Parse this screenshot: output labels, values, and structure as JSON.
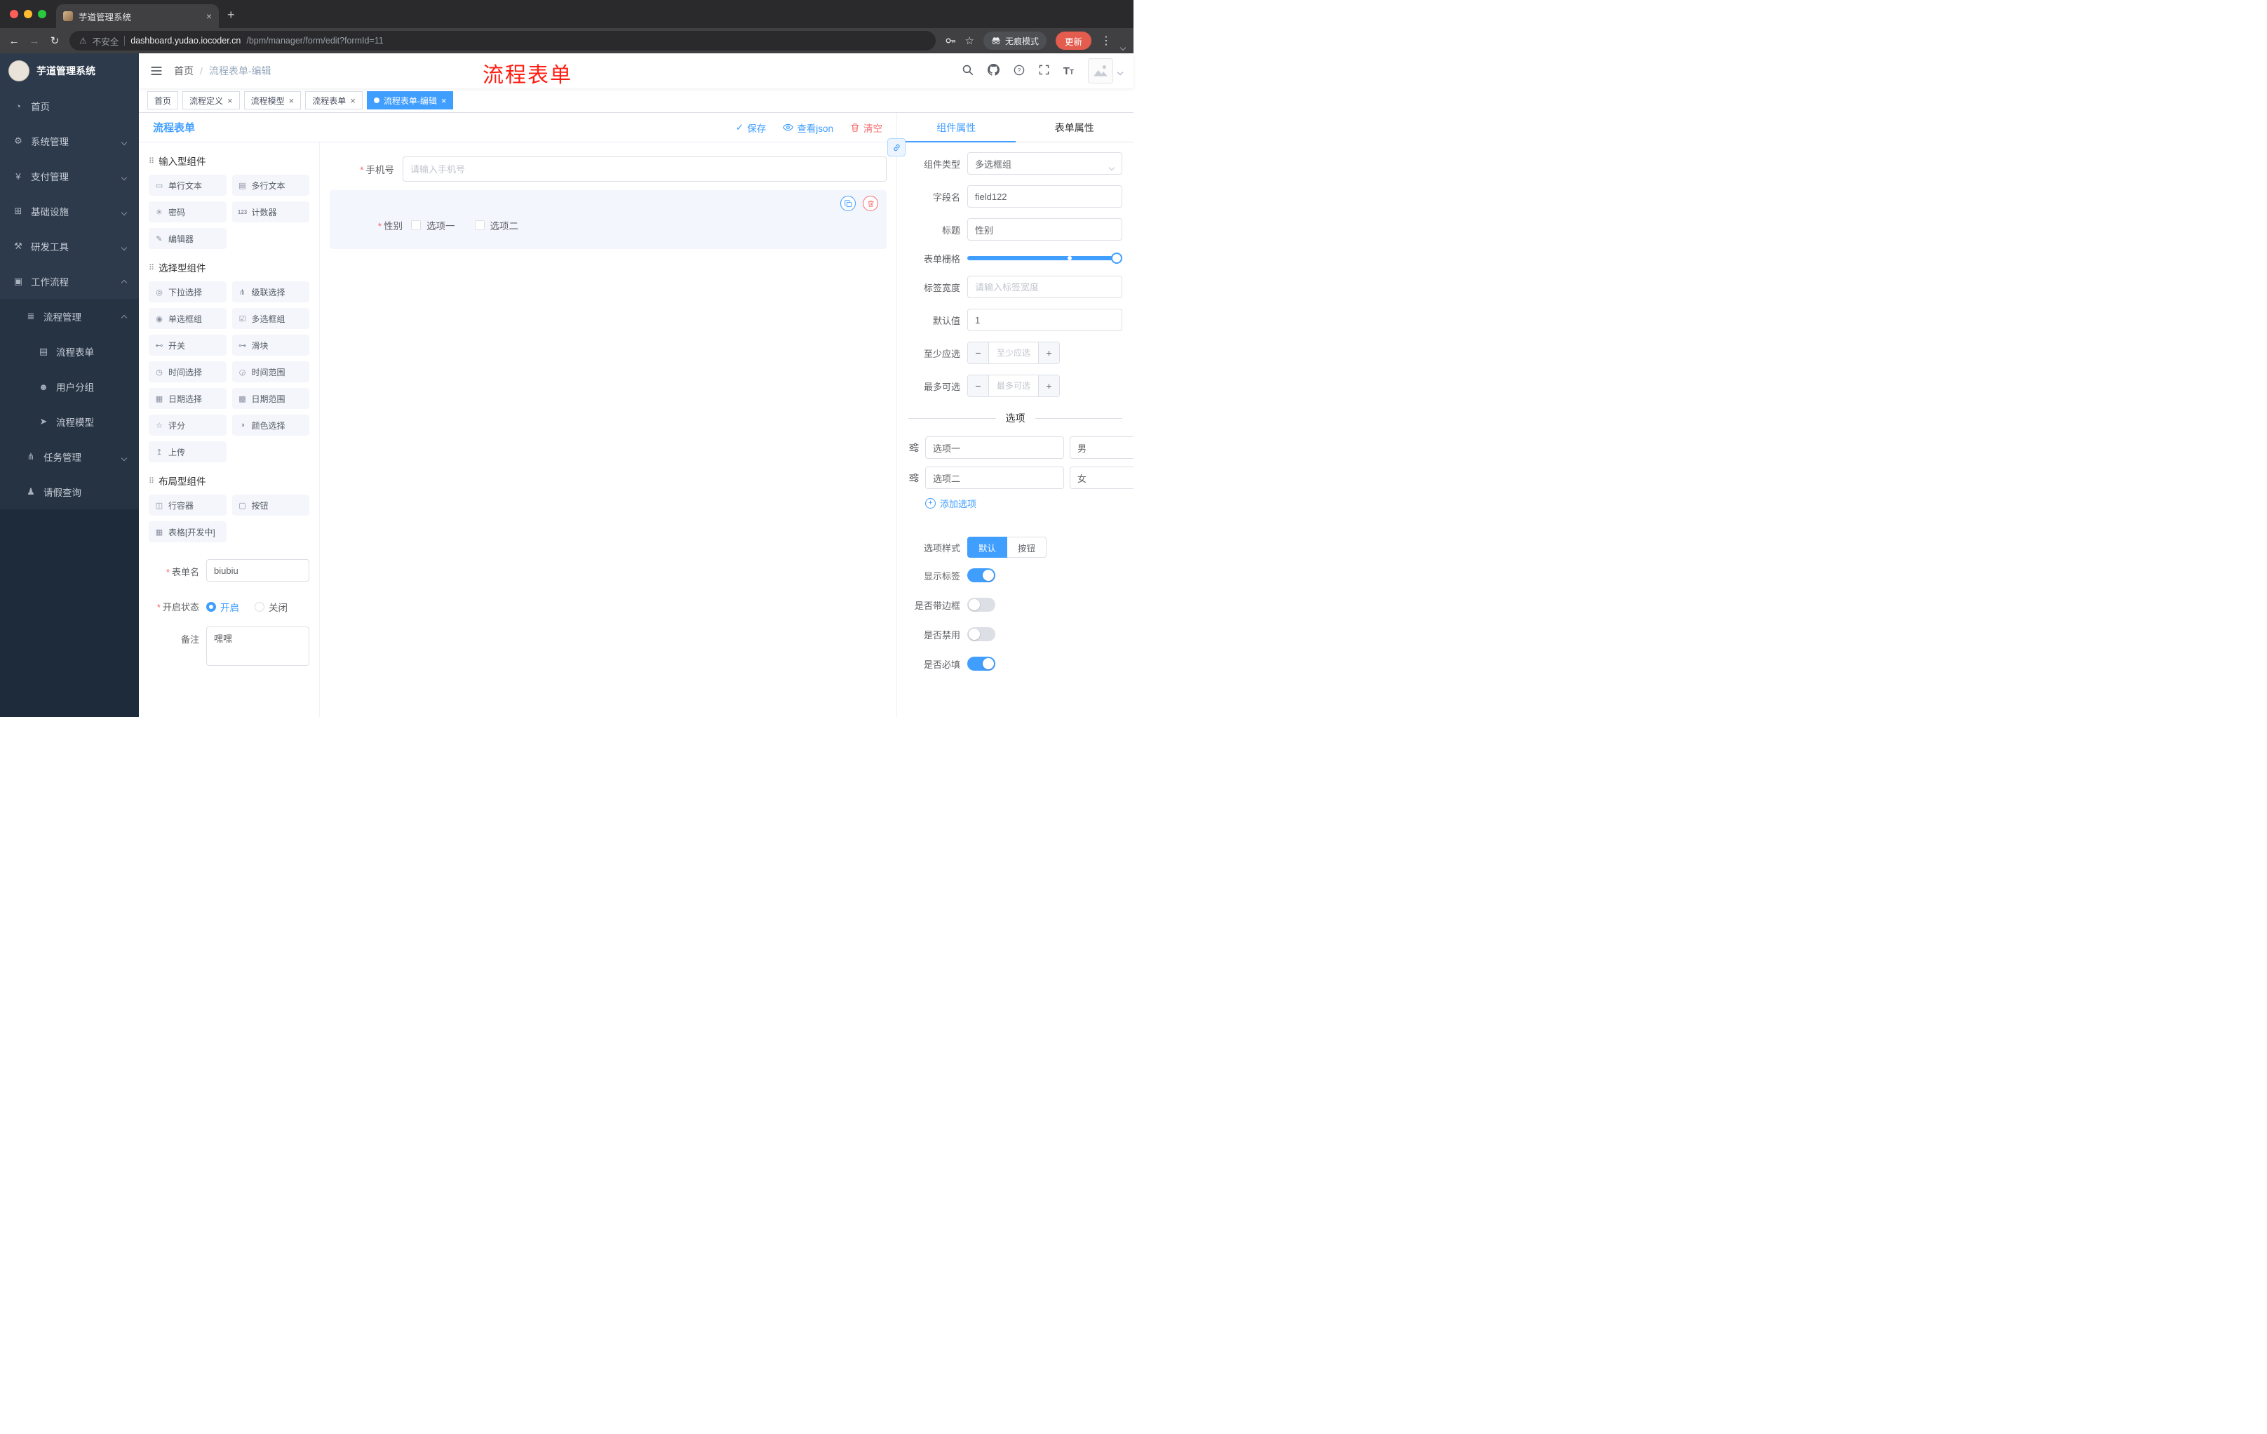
{
  "colors": {
    "primary": "#409eff",
    "danger": "#f56c6c",
    "annotation_red": "#fe1d12",
    "active_tag": "#409eff"
  },
  "icons": {
    "close": "×",
    "plus": "+",
    "minus": "−",
    "check": "✓",
    "dots": "⋮",
    "back": "←",
    "forward": "→",
    "reload": "↻",
    "warning": "⚠",
    "star": "☆",
    "menu_home": "◔",
    "menu_system": "⚙",
    "menu_pay": "¥",
    "menu_infra": "⊞",
    "menu_dev": "⚒",
    "menu_workflow": "▣",
    "menu_bpm": "≣",
    "menu_form": "▤",
    "menu_user_group": "☻",
    "menu_model": "➤",
    "menu_task": "⋔",
    "menu_leave": "♟",
    "group_handle": "⠿",
    "comp_single_line": "▭",
    "comp_multi_line": "▤",
    "comp_password": "✳",
    "comp_counter": "123",
    "comp_editor": "✎",
    "comp_select": "◎",
    "comp_cascader": "⋔",
    "comp_radio": "◉",
    "comp_checkbox": "☑",
    "comp_switch": "⊷",
    "comp_slider": "⊶",
    "comp_time": "◷",
    "comp_time_range": "◶",
    "comp_date": "▦",
    "comp_date_range": "▩",
    "comp_rate": "☆",
    "comp_color": "◑",
    "comp_upload": "↥",
    "comp_row": "◫",
    "comp_button": "▢",
    "comp_table": "▦"
  },
  "browser": {
    "tab": {
      "title": "芋道管理系统"
    },
    "address": {
      "security_label": "不安全",
      "host": "dashboard.yudao.iocoder.cn",
      "path": "/bpm/manager/form/edit?formId=11"
    },
    "incognito_label": "无痕模式",
    "update_label": "更新"
  },
  "sidebar": {
    "logo_title": "芋道管理系统",
    "menu": [
      {
        "label": "首页"
      },
      {
        "label": "系统管理"
      },
      {
        "label": "支付管理"
      },
      {
        "label": "基础设施"
      },
      {
        "label": "研发工具"
      },
      {
        "label": "工作流程"
      },
      {
        "label": "流程管理"
      },
      {
        "label": "流程表单"
      },
      {
        "label": "用户分组"
      },
      {
        "label": "流程模型"
      },
      {
        "label": "任务管理"
      },
      {
        "label": "请假查询"
      }
    ]
  },
  "navbar": {
    "breadcrumb": {
      "home": "首页",
      "current": "流程表单-编辑"
    },
    "annotation": "流程表单"
  },
  "tags": [
    {
      "label": "首页"
    },
    {
      "label": "流程定义"
    },
    {
      "label": "流程模型"
    },
    {
      "label": "流程表单"
    },
    {
      "label": "流程表单-编辑"
    }
  ],
  "designer": {
    "title": "流程表单",
    "actions": {
      "save": "保存",
      "view_json": "查看json",
      "clear": "清空"
    },
    "palette": {
      "groups": [
        {
          "title": "输入型组件",
          "items": [
            "单行文本",
            "多行文本",
            "密码",
            "计数器",
            "编辑器"
          ]
        },
        {
          "title": "选择型组件",
          "items": [
            "下拉选择",
            "级联选择",
            "单选框组",
            "多选框组",
            "开关",
            "滑块",
            "时间选择",
            "时间范围",
            "日期选择",
            "日期范围",
            "评分",
            "颜色选择",
            "上传"
          ]
        },
        {
          "title": "布局型组件",
          "items": [
            "行容器",
            "按钮",
            "表格[开发中]"
          ]
        }
      ]
    },
    "meta": {
      "form_name": {
        "label": "表单名",
        "value": "biubiu"
      },
      "status": {
        "label": "开启状态",
        "options": [
          "开启",
          "关闭"
        ],
        "selected": "开启"
      },
      "remark": {
        "label": "备注",
        "value": "嘿嘿"
      }
    },
    "canvas": {
      "phone": {
        "label": "手机号",
        "placeholder": "请输入手机号"
      },
      "gender": {
        "label": "性别",
        "options": [
          "选项一",
          "选项二"
        ]
      }
    }
  },
  "props": {
    "tabs": {
      "component": "组件属性",
      "form": "表单属性"
    },
    "component_type": {
      "label": "组件类型",
      "value": "多选框组"
    },
    "field_name": {
      "label": "字段名",
      "value": "field122"
    },
    "title": {
      "label": "标题",
      "value": "性别"
    },
    "grid": {
      "label": "表单栅格"
    },
    "label_width": {
      "label": "标签宽度",
      "placeholder": "请输入标签宽度"
    },
    "default_value": {
      "label": "默认值",
      "value": "1"
    },
    "min_select": {
      "label": "至少应选",
      "placeholder": "至少应选"
    },
    "max_select": {
      "label": "最多可选",
      "placeholder": "最多可选"
    },
    "options": {
      "divider": "选项",
      "rows": [
        {
          "label": "选项一",
          "value": "男"
        },
        {
          "label": "选项二",
          "value": "女"
        }
      ],
      "add_label": "添加选项"
    },
    "option_style": {
      "label": "选项样式",
      "options": [
        "默认",
        "按钮"
      ],
      "selected": "默认"
    },
    "switches": [
      {
        "label": "显示标签",
        "on": true
      },
      {
        "label": "是否带边框",
        "on": false
      },
      {
        "label": "是否禁用",
        "on": false
      },
      {
        "label": "是否必填",
        "on": true
      }
    ]
  }
}
